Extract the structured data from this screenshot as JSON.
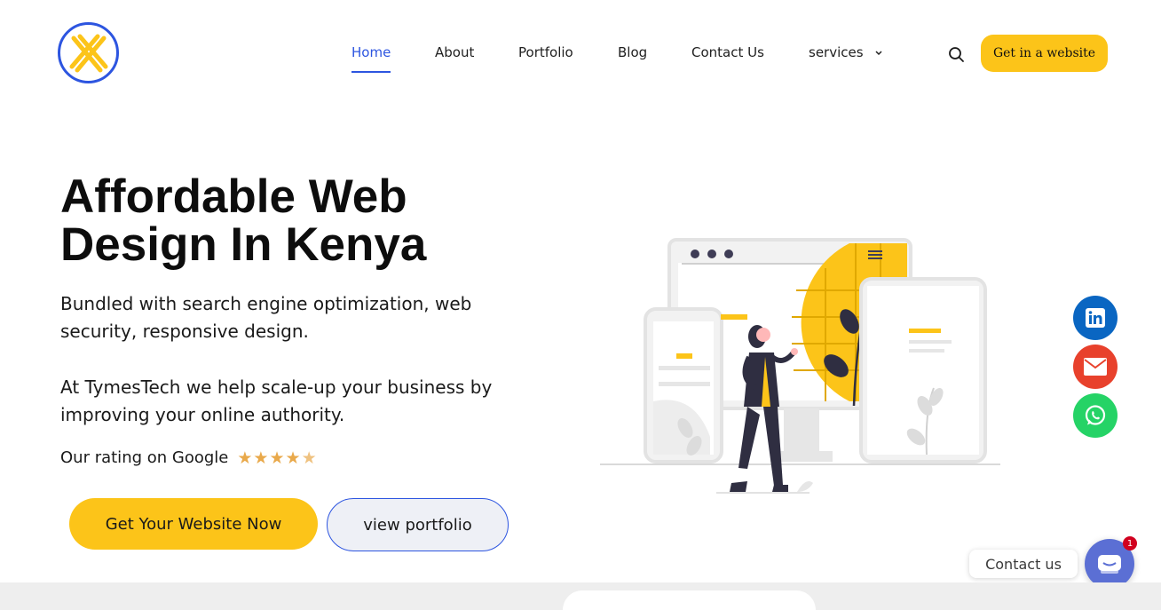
{
  "brand": {
    "logo_icon": "x-logo-icon",
    "accent": "#2d55e0",
    "yellow": "#fcc419"
  },
  "nav": {
    "items": [
      {
        "label": "Home",
        "active": true
      },
      {
        "label": "About"
      },
      {
        "label": "Portfolio"
      },
      {
        "label": "Blog"
      },
      {
        "label": "Contact Us"
      },
      {
        "label": "services",
        "icon": "chevron-down-icon"
      }
    ],
    "search_icon": "search-icon",
    "cta_label": "Get in a website"
  },
  "hero": {
    "title": "Affordable Web Design In Kenya",
    "subtitle": "Bundled with search engine optimization, web security, responsive design.",
    "subtitle2": "At TymesTech we help scale-up your business by improving your online authority.",
    "rating_label": "Our rating on Google",
    "rating_value": 4.5,
    "rating_max": 5,
    "primary_button": "Get Your Website Now",
    "secondary_button": "view portfolio"
  },
  "social": {
    "linkedin": {
      "icon": "linkedin-icon",
      "color": "#0a66c2"
    },
    "email": {
      "icon": "email-icon",
      "color": "#e8412c"
    },
    "whatsapp": {
      "icon": "whatsapp-icon",
      "color": "#25d366"
    }
  },
  "chat": {
    "label": "Contact us",
    "badge": "1",
    "icon": "chat-icon"
  }
}
